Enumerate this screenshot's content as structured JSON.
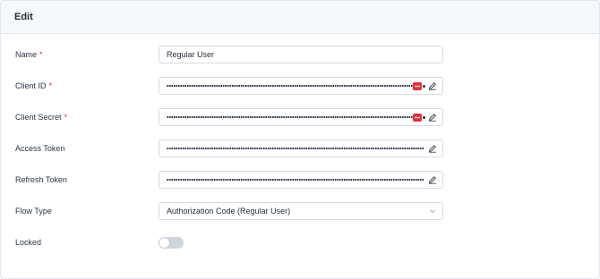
{
  "header": {
    "title": "Edit"
  },
  "fields": {
    "name": {
      "label": "Name",
      "required": "*",
      "value": "Regular User"
    },
    "client_id": {
      "label": "Client ID",
      "required": "*"
    },
    "client_secret": {
      "label": "Client Secret",
      "required": "*"
    },
    "access_token": {
      "label": "Access Token"
    },
    "refresh_token": {
      "label": "Refresh Token"
    },
    "flow_type": {
      "label": "Flow Type",
      "value": "Authorization Code (Regular User)"
    },
    "locked": {
      "label": "Locked",
      "checked": false
    }
  },
  "icons": {
    "edit": "pencil-icon",
    "select": "chevron-down-icon",
    "password_manager": "key-badge-icon"
  },
  "colors": {
    "required": "#e0313a",
    "header_bg": "#f5f8fc",
    "toggle_off": "#cfd5dd"
  }
}
